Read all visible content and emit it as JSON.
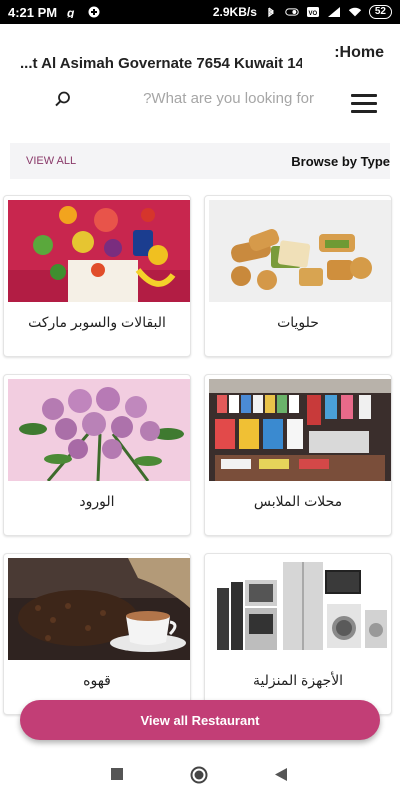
{
  "status_bar": {
    "time": "4:21 PM",
    "network_speed": "2.9KB/s",
    "battery": "52"
  },
  "header": {
    "home_title": ":Home",
    "address": "...t Al Asimah Governate 7654 Kuwait 14"
  },
  "search": {
    "placeholder": "?What are you looking for"
  },
  "browse": {
    "view_all": "VIEW ALL",
    "title": "Browse by Type"
  },
  "categories": [
    {
      "label": "البقالات والسوبر ماركت",
      "icon": "groceries-image"
    },
    {
      "label": "حلويات",
      "icon": "sweets-image"
    },
    {
      "label": "الورود",
      "icon": "flowers-image"
    },
    {
      "label": "محلات الملابس",
      "icon": "clothes-store-image"
    },
    {
      "label": "قهوه",
      "icon": "coffee-image"
    },
    {
      "label": "الأجهزة المنزلية",
      "icon": "home-appliances-image"
    }
  ],
  "buttons": {
    "view_all_restaurant": "View all Restaurant"
  },
  "colors": {
    "accent": "#c23e76",
    "browse_bar_bg": "#f4f4f6"
  }
}
